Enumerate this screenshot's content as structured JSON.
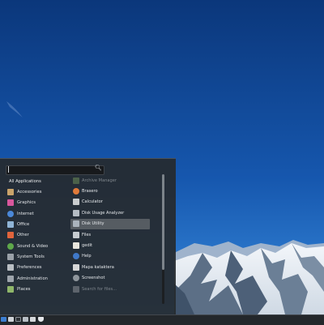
{
  "colors": {
    "sky_top": "#0d3c82",
    "sky_bottom": "#2a7ad6",
    "menu_bg": "#262a2e",
    "selected_bg": "#5f646a",
    "panel_bg": "#23272b",
    "text": "#e6e9ec",
    "text_dim": "#7f868d"
  },
  "menu": {
    "search": {
      "value": "",
      "icon": "search-icon"
    },
    "categories": [
      {
        "label": "All Applications",
        "icon": "none"
      },
      {
        "label": "Accessories",
        "icon": "accessories-icon",
        "color": "#c9a36a"
      },
      {
        "label": "Graphics",
        "icon": "graphics-icon",
        "color": "#d8579c"
      },
      {
        "label": "Internet",
        "icon": "internet-icon",
        "color": "#4a88d8"
      },
      {
        "label": "Office",
        "icon": "office-icon",
        "color": "#8fb4d6"
      },
      {
        "label": "Other",
        "icon": "other-icon",
        "color": "#e0643c"
      },
      {
        "label": "Sound & Video",
        "icon": "sound-video-icon",
        "color": "#5ea84a"
      },
      {
        "label": "System Tools",
        "icon": "system-tools-icon",
        "color": "#9aa1a8"
      },
      {
        "label": "Preferences",
        "icon": "preferences-icon",
        "color": "#b9bec3"
      },
      {
        "label": "Administration",
        "icon": "administration-icon",
        "color": "#9ea5ac"
      },
      {
        "label": "Places",
        "icon": "places-icon",
        "color": "#8fb66a"
      }
    ],
    "apps": [
      {
        "label": "Archive Manager",
        "icon": "archive-manager-icon",
        "color": "#6c8c5a",
        "dim": true
      },
      {
        "label": "Brasero",
        "icon": "brasero-icon",
        "color": "#e07a3a"
      },
      {
        "label": "Calculator",
        "icon": "calculator-icon",
        "color": "#c9ccce"
      },
      {
        "label": "Disk Usage Analyzer",
        "icon": "disk-usage-analyzer-icon",
        "color": "#b5bcc3"
      },
      {
        "label": "Disk Utility",
        "icon": "disk-utility-icon",
        "color": "#aab3bc",
        "selected": true
      },
      {
        "label": "Files",
        "icon": "files-icon",
        "color": "#c7ccd1"
      },
      {
        "label": "gedit",
        "icon": "gedit-icon",
        "color": "#e9e6dd"
      },
      {
        "label": "Help",
        "icon": "help-icon",
        "color": "#3f78c8"
      },
      {
        "label": "Mapa katakterа",
        "icon": "character-map-icon",
        "color": "#d7d7d7"
      },
      {
        "label": "Screenshot",
        "icon": "screenshot-icon",
        "color": "#8f969c"
      },
      {
        "label": "Search for files...",
        "icon": "search-files-icon",
        "color": "#8a9096",
        "dim": true
      }
    ]
  },
  "panel": {
    "icons": [
      {
        "name": "menu-icon",
        "color": "#3d7fd1"
      },
      {
        "name": "show-desktop-icon",
        "color": "#cfd3d7"
      },
      {
        "name": "terminal-icon",
        "color": "#2e3236"
      },
      {
        "name": "file-manager-icon",
        "color": "#b9bfc5"
      },
      {
        "name": "text-editor-icon",
        "color": "#d4d7da"
      },
      {
        "name": "shield-icon",
        "color": "#e5e7ea"
      }
    ]
  }
}
